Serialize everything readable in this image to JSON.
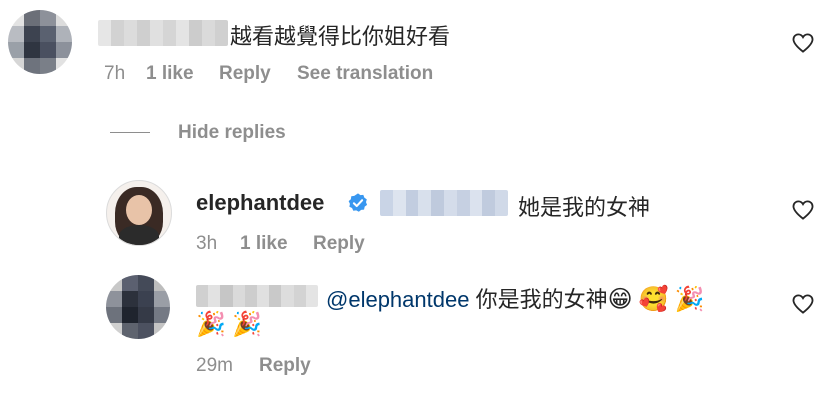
{
  "comments": [
    {
      "text": "越看越覺得比你姐好看",
      "time": "7h",
      "likes": "1 like",
      "reply_label": "Reply",
      "translate_label": "See translation"
    }
  ],
  "replies_toggle": {
    "label": "Hide replies"
  },
  "replies": [
    {
      "username": "elephantdee",
      "text": "她是我的女神",
      "time": "3h",
      "likes": "1 like",
      "reply_label": "Reply"
    },
    {
      "mention": "@elephantdee",
      "text": "你是我的女神",
      "emojis_line1": [
        "grinning-face",
        "smiling-face-with-hearts",
        "party-popper"
      ],
      "emojis_line2": [
        "party-popper",
        "party-popper"
      ],
      "time": "29m",
      "reply_label": "Reply"
    }
  ],
  "icons": {
    "grinning-face": "😁",
    "smiling-face-with-hearts": "🥰",
    "party-popper": "🎉",
    "heart": "heart-outline-icon",
    "verified": "verified-badge-icon"
  },
  "colors": {
    "meta": "#8e8e8e",
    "mention": "#00376b",
    "verified": "#3897f0"
  }
}
